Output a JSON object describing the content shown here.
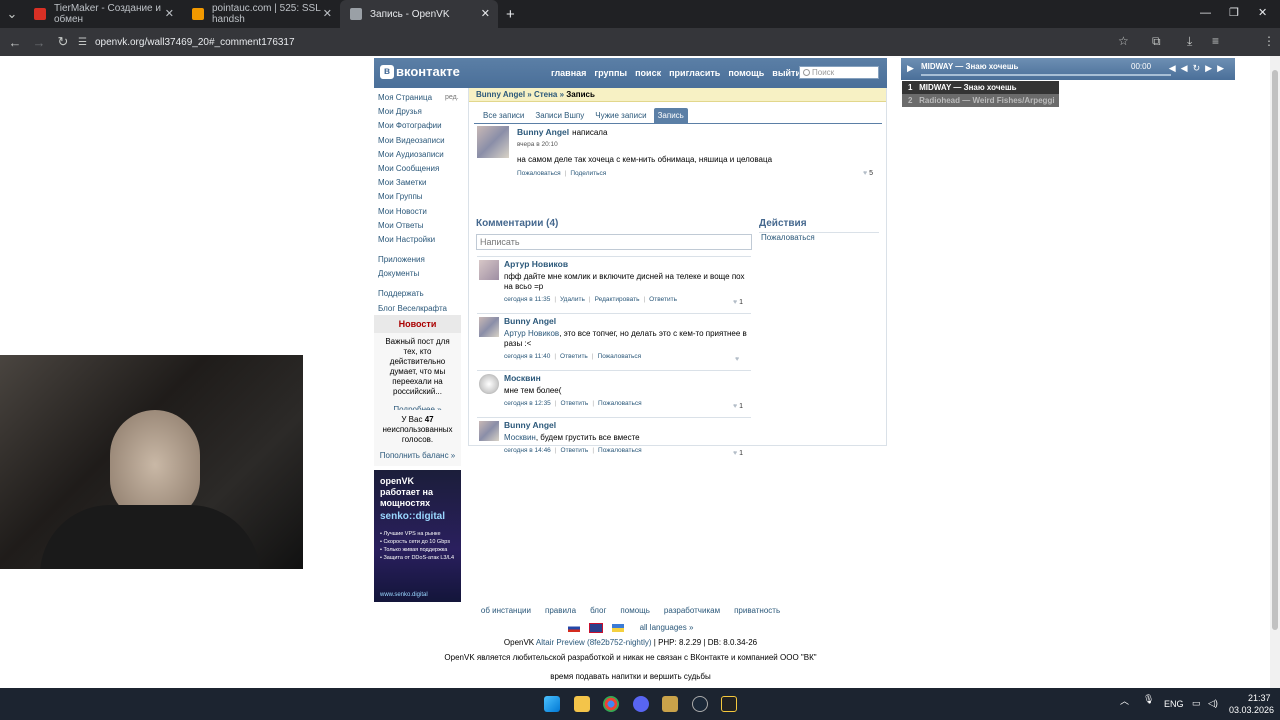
{
  "browser": {
    "tabs": [
      {
        "title": "TierMaker - Создание и обмен",
        "active": false,
        "icon_color": "#d93025"
      },
      {
        "title": "pointauc.com | 525: SSL handsh",
        "active": false,
        "icon_color": "#f29900"
      },
      {
        "title": "Запись - OpenVK",
        "active": true,
        "icon_color": "#9aa0a6"
      }
    ],
    "new_tab": "+",
    "url": "openvk.org/wall37469_20#_comment176317"
  },
  "site": {
    "logo": "вконтакте",
    "logo_badge": "в",
    "nav": [
      "главная",
      "группы",
      "поиск",
      "пригласить",
      "помощь",
      "выйти"
    ],
    "search_placeholder": "Поиск"
  },
  "sidebar": {
    "edit_link": "ред.",
    "items": [
      "Моя Страница",
      "Мои Друзья",
      "Мои Фотографии",
      "Мои Видеозаписи",
      "Мои Аудиозаписи",
      "Мои Сообщения",
      "Мои Заметки",
      "Мои Группы",
      "Мои Новости",
      "Мои Ответы",
      "Мои Настройки"
    ],
    "items2": [
      "Приложения",
      "Документы"
    ],
    "items3": [
      "Поддержать",
      "Блог Веселкрафта"
    ],
    "news": {
      "title": "Новости",
      "text": "Важный пост для тех, кто действительно думает, что мы переехали на российский...",
      "more": "Подробнее »"
    },
    "votes": {
      "pre": "У Вас",
      "count": "47",
      "post": "неиспользованных голосов.",
      "link": "Пополнить баланс »"
    },
    "ad": {
      "line1": "openVK работает на мощностях",
      "line2": "senko::digital",
      "bullets": [
        "• Лучшие VPS на рынке",
        "• Скорость сети до 10 Gbps",
        "• Только живая поддержка",
        "• Защита от DDoS-атак L3/L4"
      ],
      "footer": "www.senko.digital"
    }
  },
  "breadcrumb": {
    "user": "Bunny Angel",
    "sep1": " » ",
    "wall": "Стена",
    "sep2": " » ",
    "current": "Запись"
  },
  "tabs": [
    "Все записи",
    "Записи Вшпу",
    "Чужие записи",
    "Запись"
  ],
  "post": {
    "author": "Bunny Angel",
    "verb": "написала",
    "date": "вчера в 20:10",
    "text": "на самом деле так хочеца с кем-нить обнимаца, няшица и целоваца",
    "actions": [
      "Пожаловаться",
      "Поделиться"
    ],
    "likes": "5"
  },
  "comments_header": "Комментарии (4)",
  "actions_header": "Действия",
  "actions_link": "Пожаловаться",
  "write_placeholder": "Написать",
  "comments": [
    {
      "author": "Артур Новиков",
      "mention": "",
      "text": "пфф дайте мне комлик и включите дисней на телеке и воще пох на всьо =р",
      "date": "сегодня в 11:35",
      "actions": [
        "Удалить",
        "Редактировать",
        "Ответить"
      ],
      "likes": "1"
    },
    {
      "author": "Bunny Angel",
      "mention": "Артур Новиков",
      "text": ", это все топчег, но делать это с кем-то приятнее в разы :<",
      "date": "сегодня в 11:40",
      "actions": [
        "Ответить",
        "Пожаловаться"
      ],
      "likes": ""
    },
    {
      "author": "Москвин",
      "mention": "",
      "text": "мне тем более(",
      "date": "сегодня в 12:35",
      "actions": [
        "Ответить",
        "Пожаловаться"
      ],
      "likes": "1"
    },
    {
      "author": "Bunny Angel",
      "mention": "Москвин",
      "text": ", будем грустить все вместе",
      "date": "сегодня в 14:46",
      "actions": [
        "Ответить",
        "Пожаловаться"
      ],
      "likes": "1"
    }
  ],
  "player": {
    "title": "MIDWAY — Знаю хочешь",
    "time": "00:00",
    "playlist": [
      {
        "num": "1",
        "title": "MIDWAY — Знаю хочешь"
      },
      {
        "num": "2",
        "title": "Radiohead — Weird Fishes/Arpeggi"
      }
    ]
  },
  "footer": {
    "links": [
      "об инстанции",
      "правила",
      "блог",
      "помощь",
      "разработчикам",
      "приватность"
    ],
    "all_languages": "all languages »",
    "version_pre": "OpenVK",
    "version_link": "Altair Preview (8fe2b752-nightly)",
    "version_post": "| PHP: 8.2.29 | DB: 8.0.34-26",
    "disclaimer": "OpenVK является любительской разработкой и никак не связан с ВКонтакте и компанией ООО \"ВК\"",
    "slogan": "время подавать напитки и вершить судьбы"
  },
  "taskbar": {
    "lang": "ENG",
    "time": "21:37",
    "date": "03.03.2026"
  }
}
